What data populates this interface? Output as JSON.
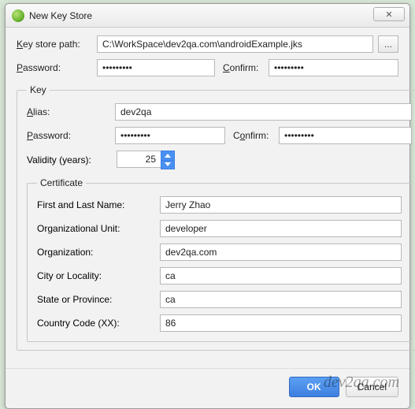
{
  "window": {
    "title": "New Key Store",
    "close_glyph": "✕"
  },
  "form": {
    "key_store_path_label_pre": "K",
    "key_store_path_label_rest": "ey store path:",
    "key_store_path_value": "C:\\WorkSpace\\dev2qa.com\\androidExample.jks",
    "browse_glyph": "...",
    "password_label_pre": "P",
    "password_label_rest": "assword:",
    "password_value": "•••••••••",
    "confirm_label_pre": "C",
    "confirm_label_rest": "onfirm:",
    "confirm_value": "•••••••••"
  },
  "key": {
    "legend": "Key",
    "alias_label_pre": "A",
    "alias_label_rest": "lias:",
    "alias_value": "dev2qa",
    "password_label_pre": "P",
    "password_label_rest": "assword:",
    "password_value": "•••••••••",
    "confirm_label": "Confirm:",
    "confirm_mn": "o",
    "confirm_value": "•••••••••",
    "validity_label_pre": "V",
    "validity_label_rest": "alidity (years):",
    "validity_value": "25"
  },
  "cert": {
    "legend": "Certificate",
    "first_last_label_pre": "F",
    "first_last_label_rest": "irst and Last Name:",
    "first_last_value": "Jerry Zhao",
    "ou_label_pre": "O",
    "ou_label_rest": "rganizational Unit:",
    "ou_value": "developer",
    "org_label": "Organization:",
    "org_mn": "z",
    "org_value": "dev2qa.com",
    "city_label": "City or ",
    "city_mn": "L",
    "city_label_post": "ocality:",
    "city_value": "ca",
    "state_label_pre": "S",
    "state_label_rest": "tate or Province:",
    "state_value": "ca",
    "cc_label": "Country Code (",
    "cc_mn": "XX",
    "cc_label_post": "):",
    "cc_value": "86"
  },
  "footer": {
    "ok": "OK",
    "cancel": "Cancel"
  },
  "watermark": "dev2qa.com"
}
